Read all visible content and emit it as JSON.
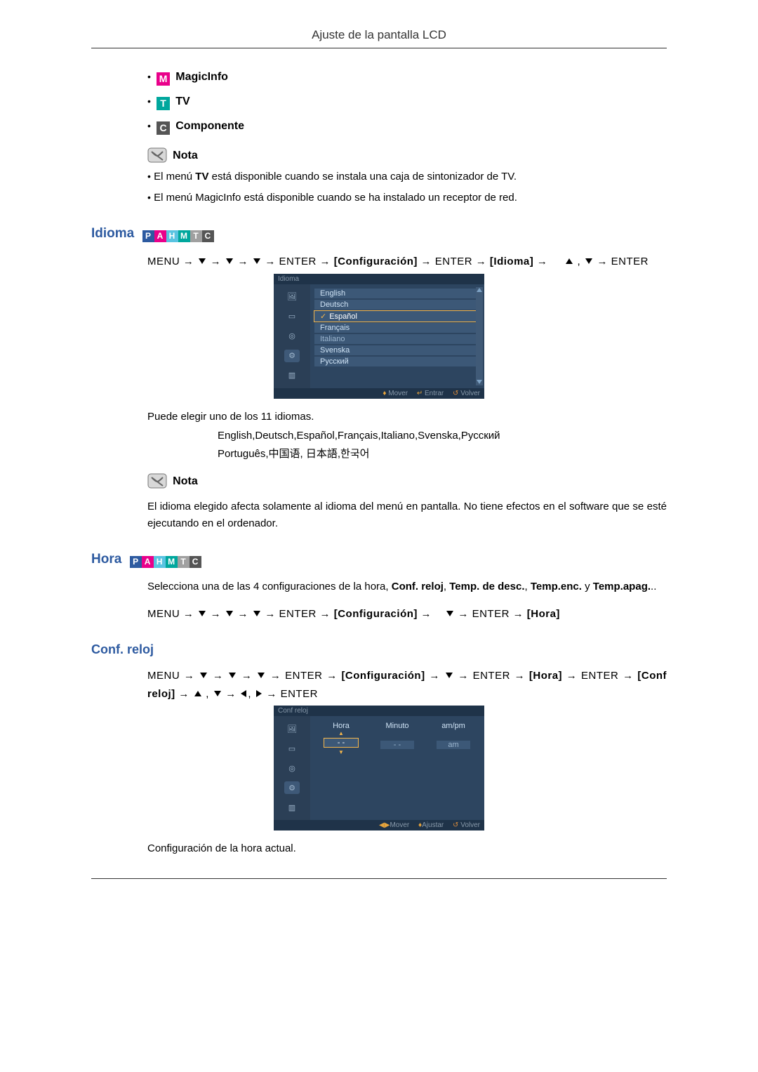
{
  "header": {
    "title": "Ajuste de la pantalla LCD"
  },
  "sources": {
    "magicinfo": {
      "letter": "M",
      "label": "MagicInfo"
    },
    "tv": {
      "letter": "T",
      "label": "TV"
    },
    "comp": {
      "letter": "C",
      "label": "Componente"
    }
  },
  "note_label": "Nota",
  "notes_top": {
    "line1": "El menú TV está disponible cuando se instala una caja de sintonizador de TV.",
    "line2": "El menú MagicInfo está disponible cuando se ha instalado un receptor de red."
  },
  "idioma": {
    "heading": "Idioma",
    "nav": {
      "menu": "MENU",
      "enter": "ENTER",
      "step1": "[Configuración]",
      "step2": "[Idioma]"
    },
    "osd_title": "Idioma",
    "osd_items": [
      "English",
      "Deutsch",
      "Español",
      "Français",
      "Italiano",
      "Svenska",
      "Русский"
    ],
    "osd_selected": "Español",
    "osd_foot": {
      "move": "Mover",
      "enter": "Entrar",
      "return": "Volver"
    },
    "body1": "Puede elegir uno de los 11 idiomas.",
    "lang_line1": "English,Deutsch,Español,Français,Italiano,Svenska,Русский",
    "lang_line2": "Português,中国语, 日本語,한국어",
    "note_body": "El idioma elegido afecta solamente al idioma del menú en pantalla. No tiene efectos en el software que se esté ejecutando en el ordenador."
  },
  "hora": {
    "heading": "Hora",
    "intro_a": "Selecciona una de las 4 configuraciones de la hora, ",
    "b1": "Conf. reloj",
    "b2": "Temp. de desc.",
    "b3": "Temp.enc.",
    "b4": "Temp.apag.",
    "intro_y": " y ",
    "intro_end": "..",
    "nav": {
      "menu": "MENU",
      "enter": "ENTER",
      "step1": "[Configuración]",
      "step2": "[Hora]"
    }
  },
  "confreloj": {
    "heading": "Conf. reloj",
    "nav": {
      "menu": "MENU",
      "enter": "ENTER",
      "step1": "[Configuración]",
      "step2": "[Hora]",
      "step3": "[Conf reloj]"
    },
    "osd_title": "Conf reloj",
    "cols": {
      "hora": "Hora",
      "minuto": "Minuto",
      "ampm": "am/pm"
    },
    "vals": {
      "hora": "- -",
      "minuto": "- -",
      "ampm": "am"
    },
    "osd_foot": {
      "move": "Mover",
      "adjust": "Ajustar",
      "return": "Volver"
    },
    "body": "Configuración de la hora actual."
  },
  "sig": {
    "P": "P",
    "A": "A",
    "H": "H",
    "M": "M",
    "T": "T",
    "C": "C"
  }
}
